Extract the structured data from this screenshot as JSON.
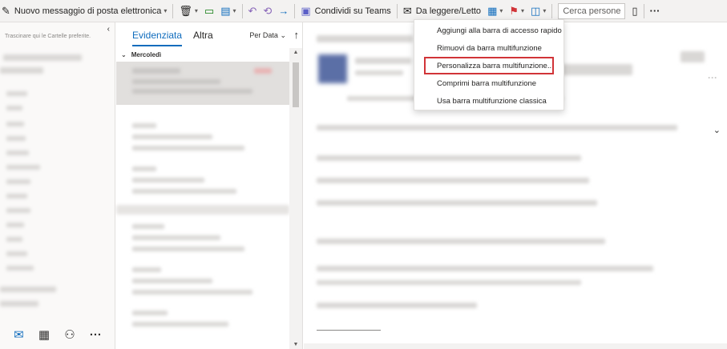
{
  "ribbon": {
    "new_message_label": "Nuovo messaggio di posta elettronica",
    "share_teams_label": "Condividi su Teams",
    "read_unread_label": "Da leggere/Letto",
    "search_people_placeholder": "Cerca persone",
    "more_label": "···"
  },
  "folders": {
    "favorites_hint": "Trascinare qui le Cartelle preferite."
  },
  "message_list": {
    "tabs": [
      {
        "label": "Evidenziata",
        "active": true
      },
      {
        "label": "Altra",
        "active": false
      }
    ],
    "sort_label": "Per Data",
    "group_header": "Mercoledì"
  },
  "context_menu": {
    "items": [
      {
        "label": "Aggiungi alla barra di accesso rapido",
        "highlighted": false
      },
      {
        "label": "Rimuovi da barra multifunzione",
        "highlighted": false
      },
      {
        "label": "Personalizza barra multifunzione...",
        "highlighted": true
      },
      {
        "label": "Comprimi barra multifunzione",
        "highlighted": false
      },
      {
        "label": "Usa barra multifunzione classica",
        "highlighted": false
      }
    ]
  },
  "colors": {
    "accent": "#0f6cbd",
    "highlight_border": "#d13438",
    "ribbon_bg": "#f3f2f1"
  },
  "icons": [
    "compose-icon",
    "delete-icon",
    "archive-icon",
    "move-icon",
    "reply-icon",
    "reply-all-icon",
    "forward-icon",
    "teams-icon",
    "envelope-open-icon",
    "categories-icon",
    "flag-icon",
    "schedule-icon",
    "contact-card-icon",
    "mail-icon",
    "calendar-icon",
    "people-icon"
  ]
}
